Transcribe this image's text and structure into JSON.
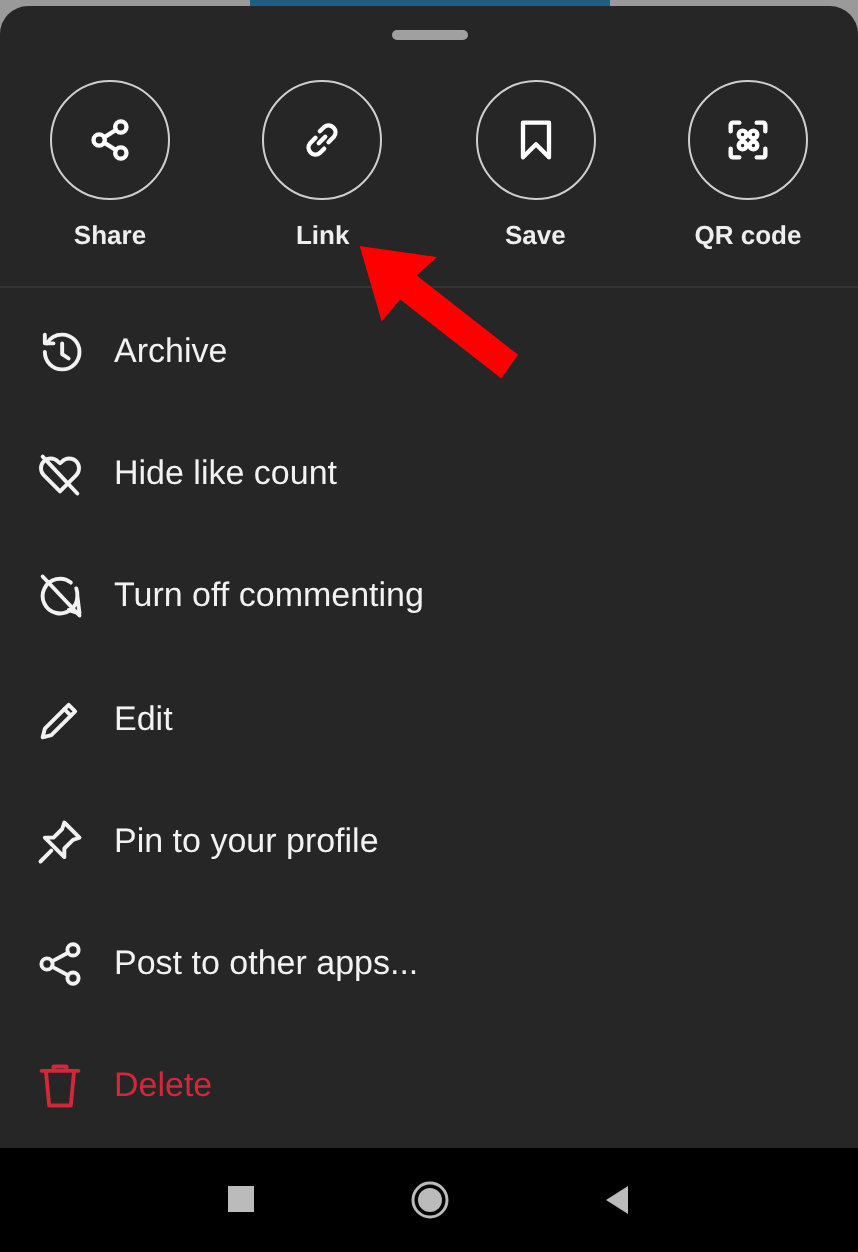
{
  "share_actions": [
    {
      "label": "Share"
    },
    {
      "label": "Link"
    },
    {
      "label": "Save"
    },
    {
      "label": "QR code"
    }
  ],
  "menu_items": [
    {
      "label": "Archive",
      "kind": "normal"
    },
    {
      "label": "Hide like count",
      "kind": "normal"
    },
    {
      "label": "Turn off commenting",
      "kind": "normal"
    },
    {
      "label": "Edit",
      "kind": "normal"
    },
    {
      "label": "Pin to your profile",
      "kind": "normal"
    },
    {
      "label": "Post to other apps...",
      "kind": "normal"
    },
    {
      "label": "Delete",
      "kind": "danger"
    }
  ]
}
